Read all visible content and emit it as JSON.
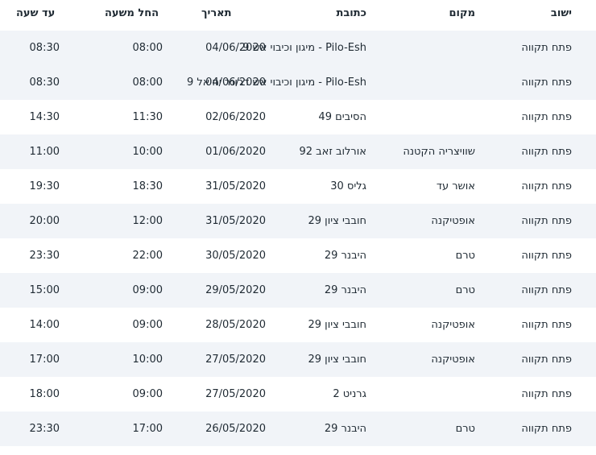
{
  "table": {
    "headers": {
      "city": "ישוב",
      "place": "מקום",
      "address": "כתובת",
      "date": "תאריך",
      "from": "החל משעה",
      "to": "עד שעה"
    },
    "rows": [
      {
        "city": "פתח תקווה",
        "place": "",
        "address": "Pilo-Esh - מיגון וכיבוי אש 9",
        "date": "04/06/2020",
        "from": "08:00",
        "to": "08:30"
      },
      {
        "city": "פתח תקווה",
        "place": "",
        "address": "Pilo-Esh - מיגון וכיבוי אש דרונר יחיאל 9",
        "date": "04/06/2020",
        "from": "08:00",
        "to": "08:30"
      },
      {
        "city": "פתח תקווה",
        "place": "",
        "address": "הסיבים 49",
        "date": "02/06/2020",
        "from": "11:30",
        "to": "14:30"
      },
      {
        "city": "פתח תקווה",
        "place": "שוויצריה הקטנה",
        "address": "אורלוב זאב 92",
        "date": "01/06/2020",
        "from": "10:00",
        "to": "11:00"
      },
      {
        "city": "פתח תקווה",
        "place": "אושר עד",
        "address": "גליס 30",
        "date": "31/05/2020",
        "from": "18:30",
        "to": "19:30"
      },
      {
        "city": "פתח תקווה",
        "place": "אופטיקנה",
        "address": "חובבי ציון 29",
        "date": "31/05/2020",
        "from": "12:00",
        "to": "20:00"
      },
      {
        "city": "פתח תקווה",
        "place": "טרם",
        "address": "היבנר 29",
        "date": "30/05/2020",
        "from": "22:00",
        "to": "23:30"
      },
      {
        "city": "פתח תקווה",
        "place": "טרם",
        "address": "היבנר 29",
        "date": "29/05/2020",
        "from": "09:00",
        "to": "15:00"
      },
      {
        "city": "פתח תקווה",
        "place": "אופטיקנה",
        "address": "חובבי ציון 29",
        "date": "28/05/2020",
        "from": "09:00",
        "to": "14:00"
      },
      {
        "city": "פתח תקווה",
        "place": "אופטיקנה",
        "address": "חובבי ציון 29",
        "date": "27/05/2020",
        "from": "10:00",
        "to": "17:00"
      },
      {
        "city": "פתח תקווה",
        "place": "",
        "address": "גרניט 2",
        "date": "27/05/2020",
        "from": "09:00",
        "to": "18:00"
      },
      {
        "city": "פתח תקווה",
        "place": "טרם",
        "address": "היבנר 29",
        "date": "26/05/2020",
        "from": "17:00",
        "to": "23:30"
      }
    ]
  },
  "colors": {
    "row_shade": "#f1f4f8",
    "text": "#1f2a33"
  }
}
